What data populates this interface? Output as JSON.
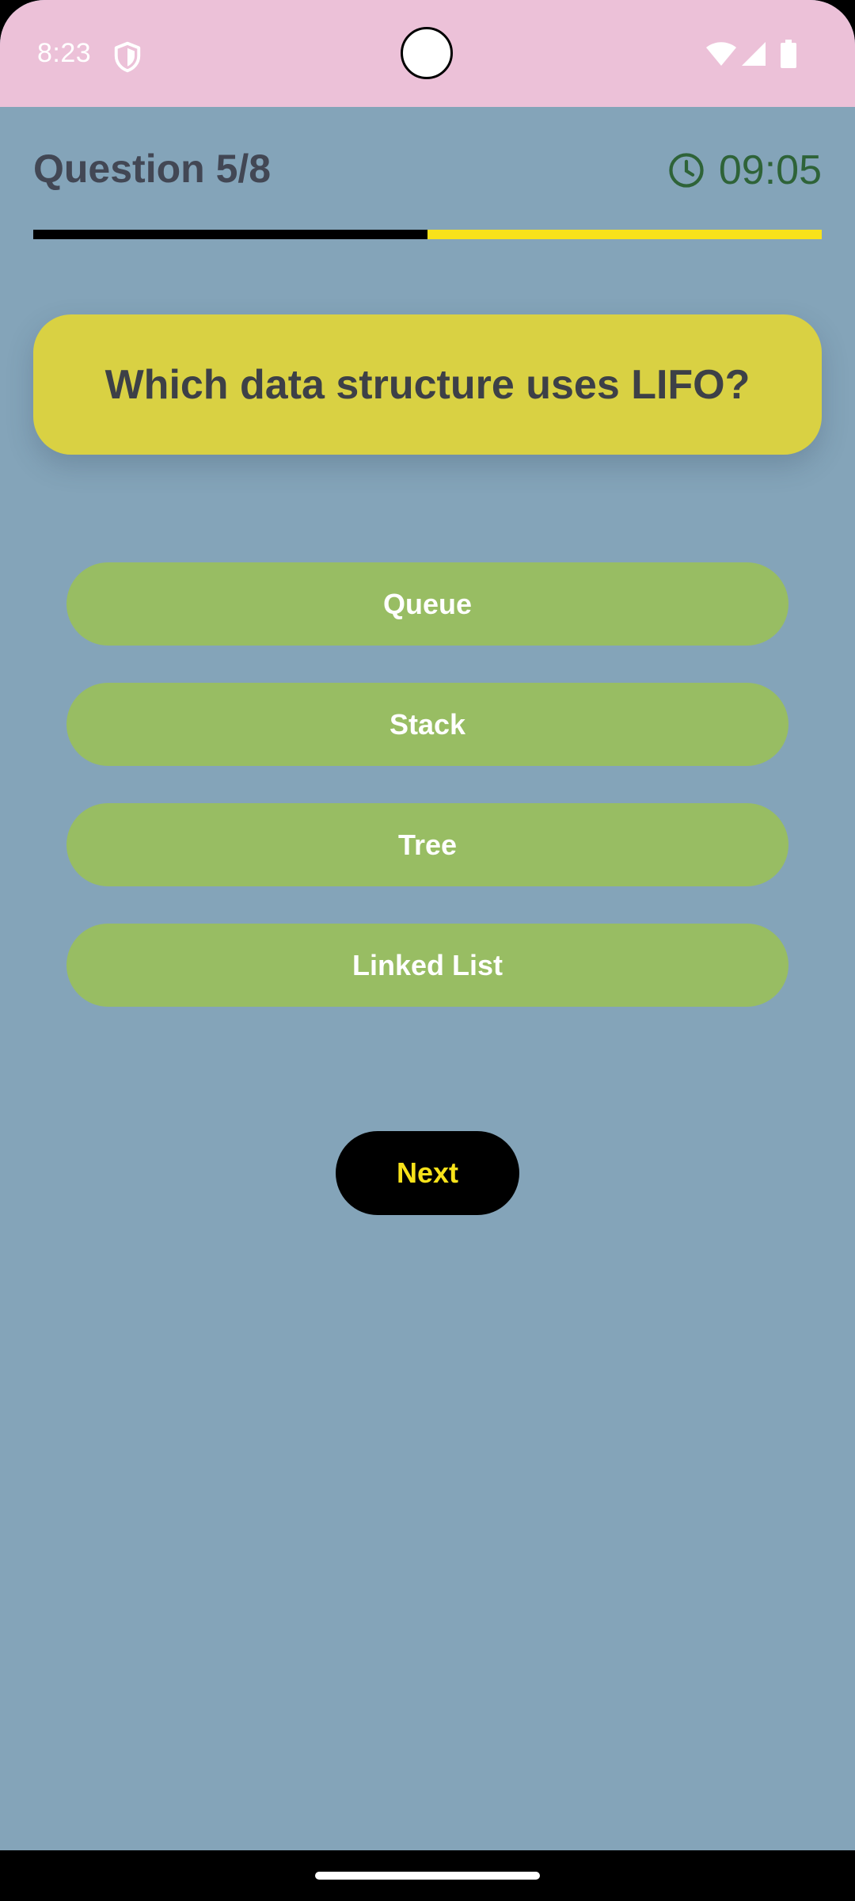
{
  "status_bar": {
    "time": "8:23",
    "icons": [
      "shield-icon",
      "wifi-icon",
      "signal-icon",
      "battery-icon"
    ],
    "background": "#ecc1d8"
  },
  "header": {
    "question_counter": "Question 5/8",
    "timer": "09:05",
    "timer_icon": "clock-icon",
    "timer_color": "#2e6338"
  },
  "progress": {
    "current": 5,
    "total": 8,
    "fraction": 0.5,
    "fill_color": "#000000",
    "track_color": "#f8e21a"
  },
  "question": {
    "text": "Which data structure uses LIFO?",
    "card_color": "#d9d143"
  },
  "options": [
    {
      "label": "Queue"
    },
    {
      "label": "Stack"
    },
    {
      "label": "Tree"
    },
    {
      "label": "Linked List"
    }
  ],
  "option_color": "#98bd63",
  "next_button": {
    "label": "Next",
    "background": "#000000",
    "text_color": "#f8e21a"
  },
  "background_color": "#84a4b9"
}
